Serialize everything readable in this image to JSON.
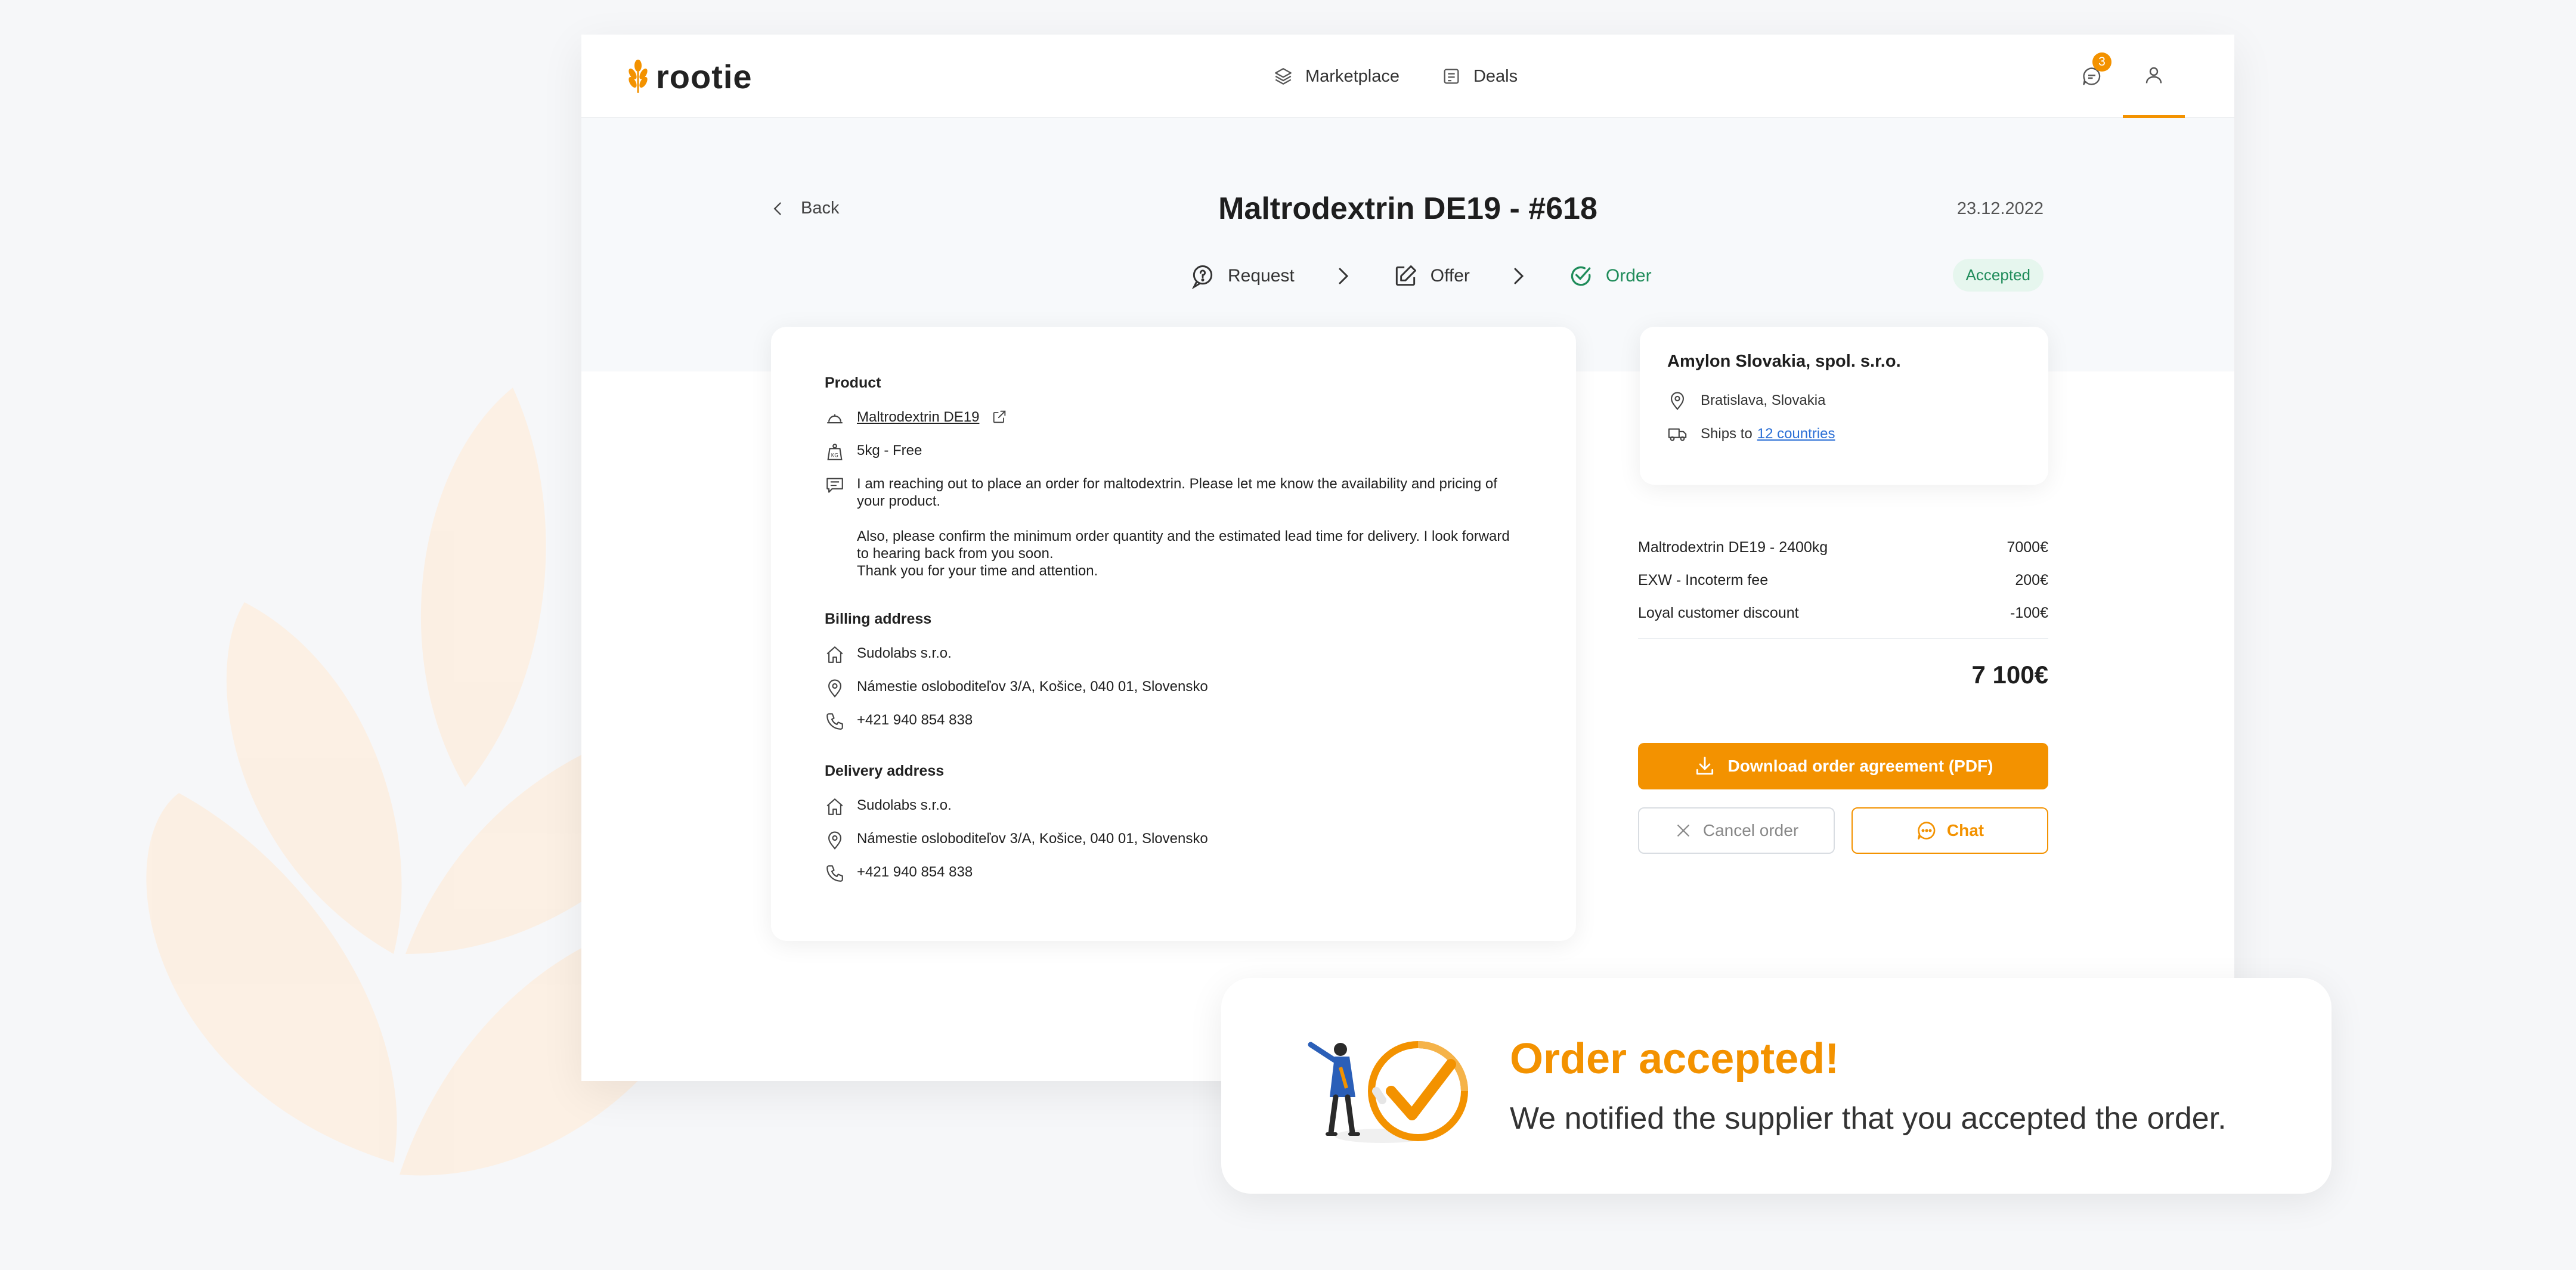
{
  "brand": {
    "name": "rootie",
    "accent": "#f39200",
    "success": "#1f8c5a",
    "link": "#2b6fd6"
  },
  "nav": {
    "items": [
      {
        "label": "Marketplace",
        "icon": "layers-icon"
      },
      {
        "label": "Deals",
        "icon": "deals-icon"
      }
    ],
    "messages_badge": "3"
  },
  "header": {
    "back_label": "Back",
    "title": "Maltrodextrin DE19 - #618",
    "date": "23.12.2022",
    "status": "Accepted"
  },
  "steps": [
    {
      "label": "Request",
      "icon": "question-chat-icon"
    },
    {
      "label": "Offer",
      "icon": "edit-icon"
    },
    {
      "label": "Order",
      "icon": "check-circle-icon"
    }
  ],
  "product": {
    "section_title": "Product",
    "name": "Maltrodextrin DE19",
    "package": "5kg - Free",
    "message": [
      "I am reaching out to place an order for maltodextrin. Please let me know the availability and pricing of your product.",
      "Also, please confirm the minimum order quantity and the estimated lead time for delivery. I look forward to hearing back from you soon.",
      "Thank you for your time and attention."
    ]
  },
  "billing": {
    "section_title": "Billing address",
    "company": "Sudolabs s.r.o.",
    "address": "Námestie osloboditeľov 3/A, Košice, 040 01, Slovensko",
    "phone": "+421 940 854 838"
  },
  "delivery": {
    "section_title": "Delivery address",
    "company": "Sudolabs s.r.o.",
    "address": "Námestie osloboditeľov 3/A, Košice, 040 01, Slovensko",
    "phone": "+421 940 854 838"
  },
  "supplier": {
    "name": "Amylon Slovakia, spol. s.r.o.",
    "location": "Bratislava, Slovakia",
    "ships_prefix": "Ships to",
    "ships_link": "12 countries"
  },
  "pricing": {
    "lines": [
      {
        "label": "Maltrodextrin DE19 - 2400kg",
        "amount": "7000€"
      },
      {
        "label": "EXW - Incoterm fee",
        "amount": "200€"
      },
      {
        "label": "Loyal customer discount",
        "amount": "-100€"
      }
    ],
    "total": "7 100€"
  },
  "actions": {
    "download": "Download order agreement (PDF)",
    "cancel": "Cancel order",
    "chat": "Chat"
  },
  "toast": {
    "title": "Order accepted!",
    "message": "We notified the supplier that you accepted the order."
  }
}
